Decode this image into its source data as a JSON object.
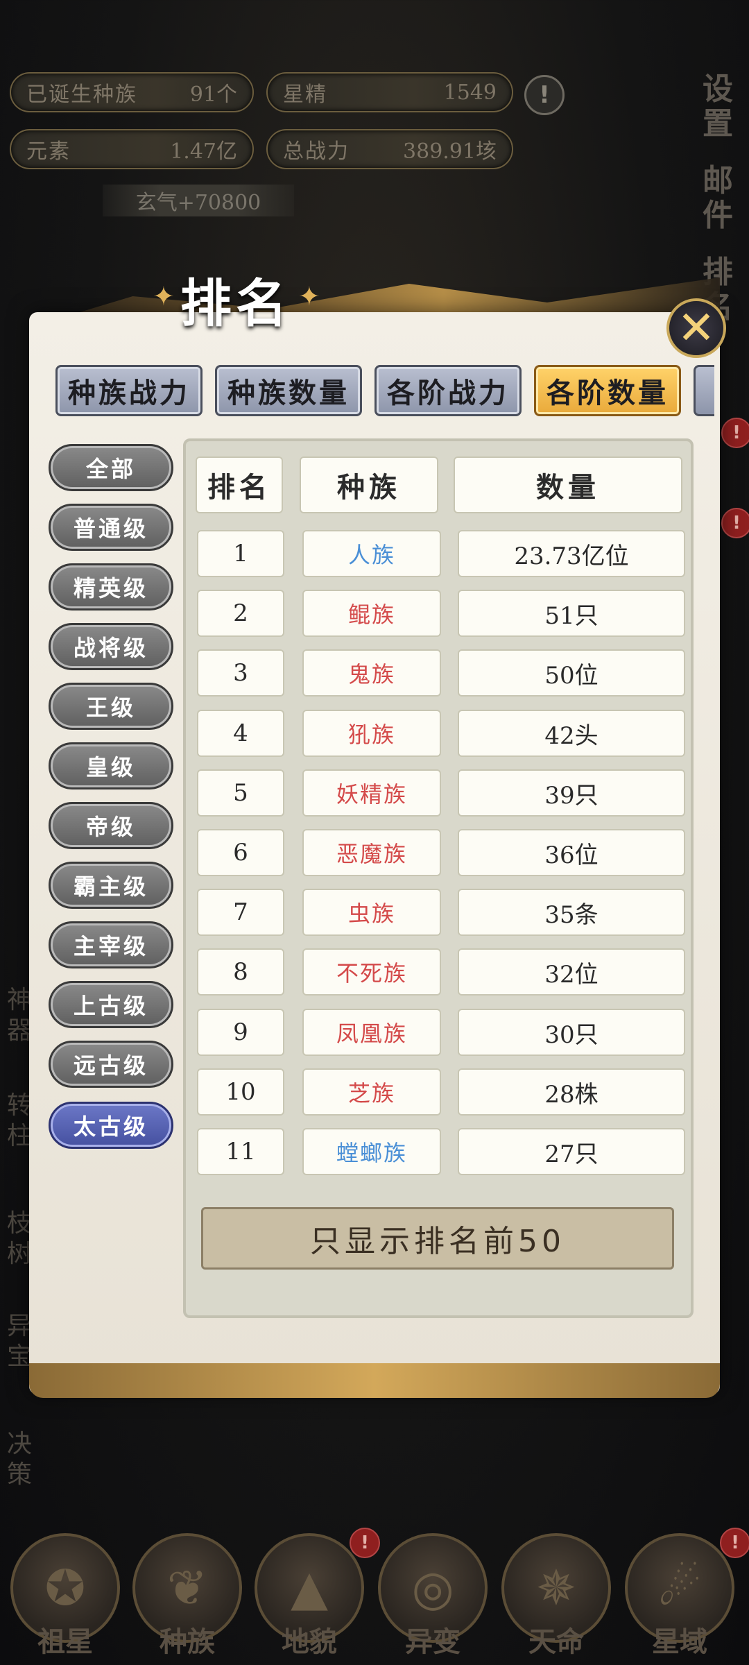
{
  "hud": {
    "races_born_label": "已诞生种族",
    "races_born_value": "91个",
    "star_essence_label": "星精",
    "star_essence_value": "1549",
    "element_label": "元素",
    "element_value": "1.47亿",
    "total_power_label": "总战力",
    "total_power_value": "389.91垓",
    "xuanqi": "玄气+70800"
  },
  "side_right": [
    "设\n置",
    "邮\n件",
    "排\n名"
  ],
  "side_left": [
    "神\n器",
    "转\n柱",
    "枝\n树",
    "异\n宝",
    "决\n策"
  ],
  "bottom_nav": [
    {
      "label": "祖星",
      "icon": "star-orbit-icon"
    },
    {
      "label": "种族",
      "icon": "race-icon"
    },
    {
      "label": "地貌",
      "icon": "landscape-icon"
    },
    {
      "label": "异变",
      "icon": "vortex-icon"
    },
    {
      "label": "天命",
      "icon": "fate-icon"
    },
    {
      "label": "星域",
      "icon": "star-domain-icon"
    }
  ],
  "modal": {
    "title": "排名",
    "close": "✕",
    "tabs": [
      "种族战力",
      "种族数量",
      "各阶战力",
      "各阶数量"
    ],
    "active_tab": 3,
    "levels": [
      "全部",
      "普通级",
      "精英级",
      "战将级",
      "王级",
      "皇级",
      "帝级",
      "霸主级",
      "主宰级",
      "上古级",
      "远古级",
      "太古级"
    ],
    "active_level": 11,
    "table": {
      "headers": [
        "排名",
        "种族",
        "数量"
      ],
      "rows": [
        {
          "rank": "1",
          "race": "人族",
          "count": "23.73亿位",
          "color": "blue"
        },
        {
          "rank": "2",
          "race": "鲲族",
          "count": "51只",
          "color": "red"
        },
        {
          "rank": "3",
          "race": "鬼族",
          "count": "50位",
          "color": "red"
        },
        {
          "rank": "4",
          "race": "犼族",
          "count": "42头",
          "color": "red"
        },
        {
          "rank": "5",
          "race": "妖精族",
          "count": "39只",
          "color": "red"
        },
        {
          "rank": "6",
          "race": "恶魔族",
          "count": "36位",
          "color": "red"
        },
        {
          "rank": "7",
          "race": "虫族",
          "count": "35条",
          "color": "red"
        },
        {
          "rank": "8",
          "race": "不死族",
          "count": "32位",
          "color": "red"
        },
        {
          "rank": "9",
          "race": "凤凰族",
          "count": "30只",
          "color": "red"
        },
        {
          "rank": "10",
          "race": "芝族",
          "count": "28株",
          "color": "red"
        },
        {
          "rank": "11",
          "race": "螳螂族",
          "count": "27只",
          "color": "blue"
        }
      ]
    },
    "footer": "只显示排名前50"
  },
  "colors": {
    "blue_race": "#4a8fd6",
    "red_race": "#d44a4a",
    "active_tab": "#f2b94c",
    "active_level": "#5a64b4"
  }
}
